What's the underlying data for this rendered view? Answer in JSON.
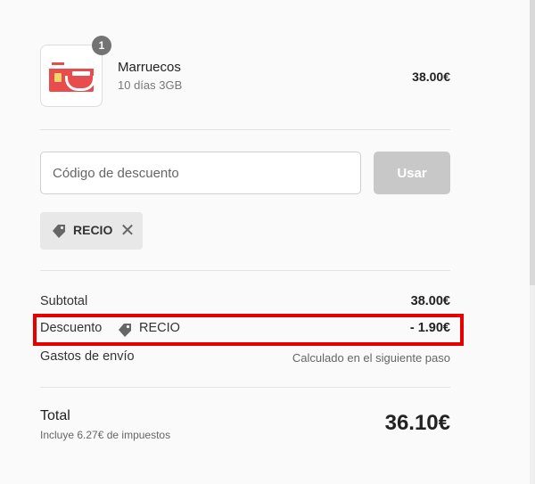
{
  "product": {
    "quantity": "1",
    "name": "Marruecos",
    "variant": "10 días 3GB",
    "price": "38.00€"
  },
  "discount": {
    "placeholder": "Código de descuento",
    "apply_label": "Usar",
    "applied_code": "RECIO"
  },
  "summary": {
    "subtotal_label": "Subtotal",
    "subtotal_value": "38.00€",
    "discount_label": "Descuento",
    "discount_code": "RECIO",
    "discount_value": "- 1.90€",
    "shipping_label": "Gastos de envío",
    "shipping_value": "Calculado en el siguiente paso"
  },
  "total": {
    "label": "Total",
    "tax_note": "Incluye 6.27€ de impuestos",
    "value": "36.10€"
  },
  "colors": {
    "highlight": "#e60000",
    "sim_red": "#e84c4c",
    "button_disabled": "#c8c8c8"
  }
}
